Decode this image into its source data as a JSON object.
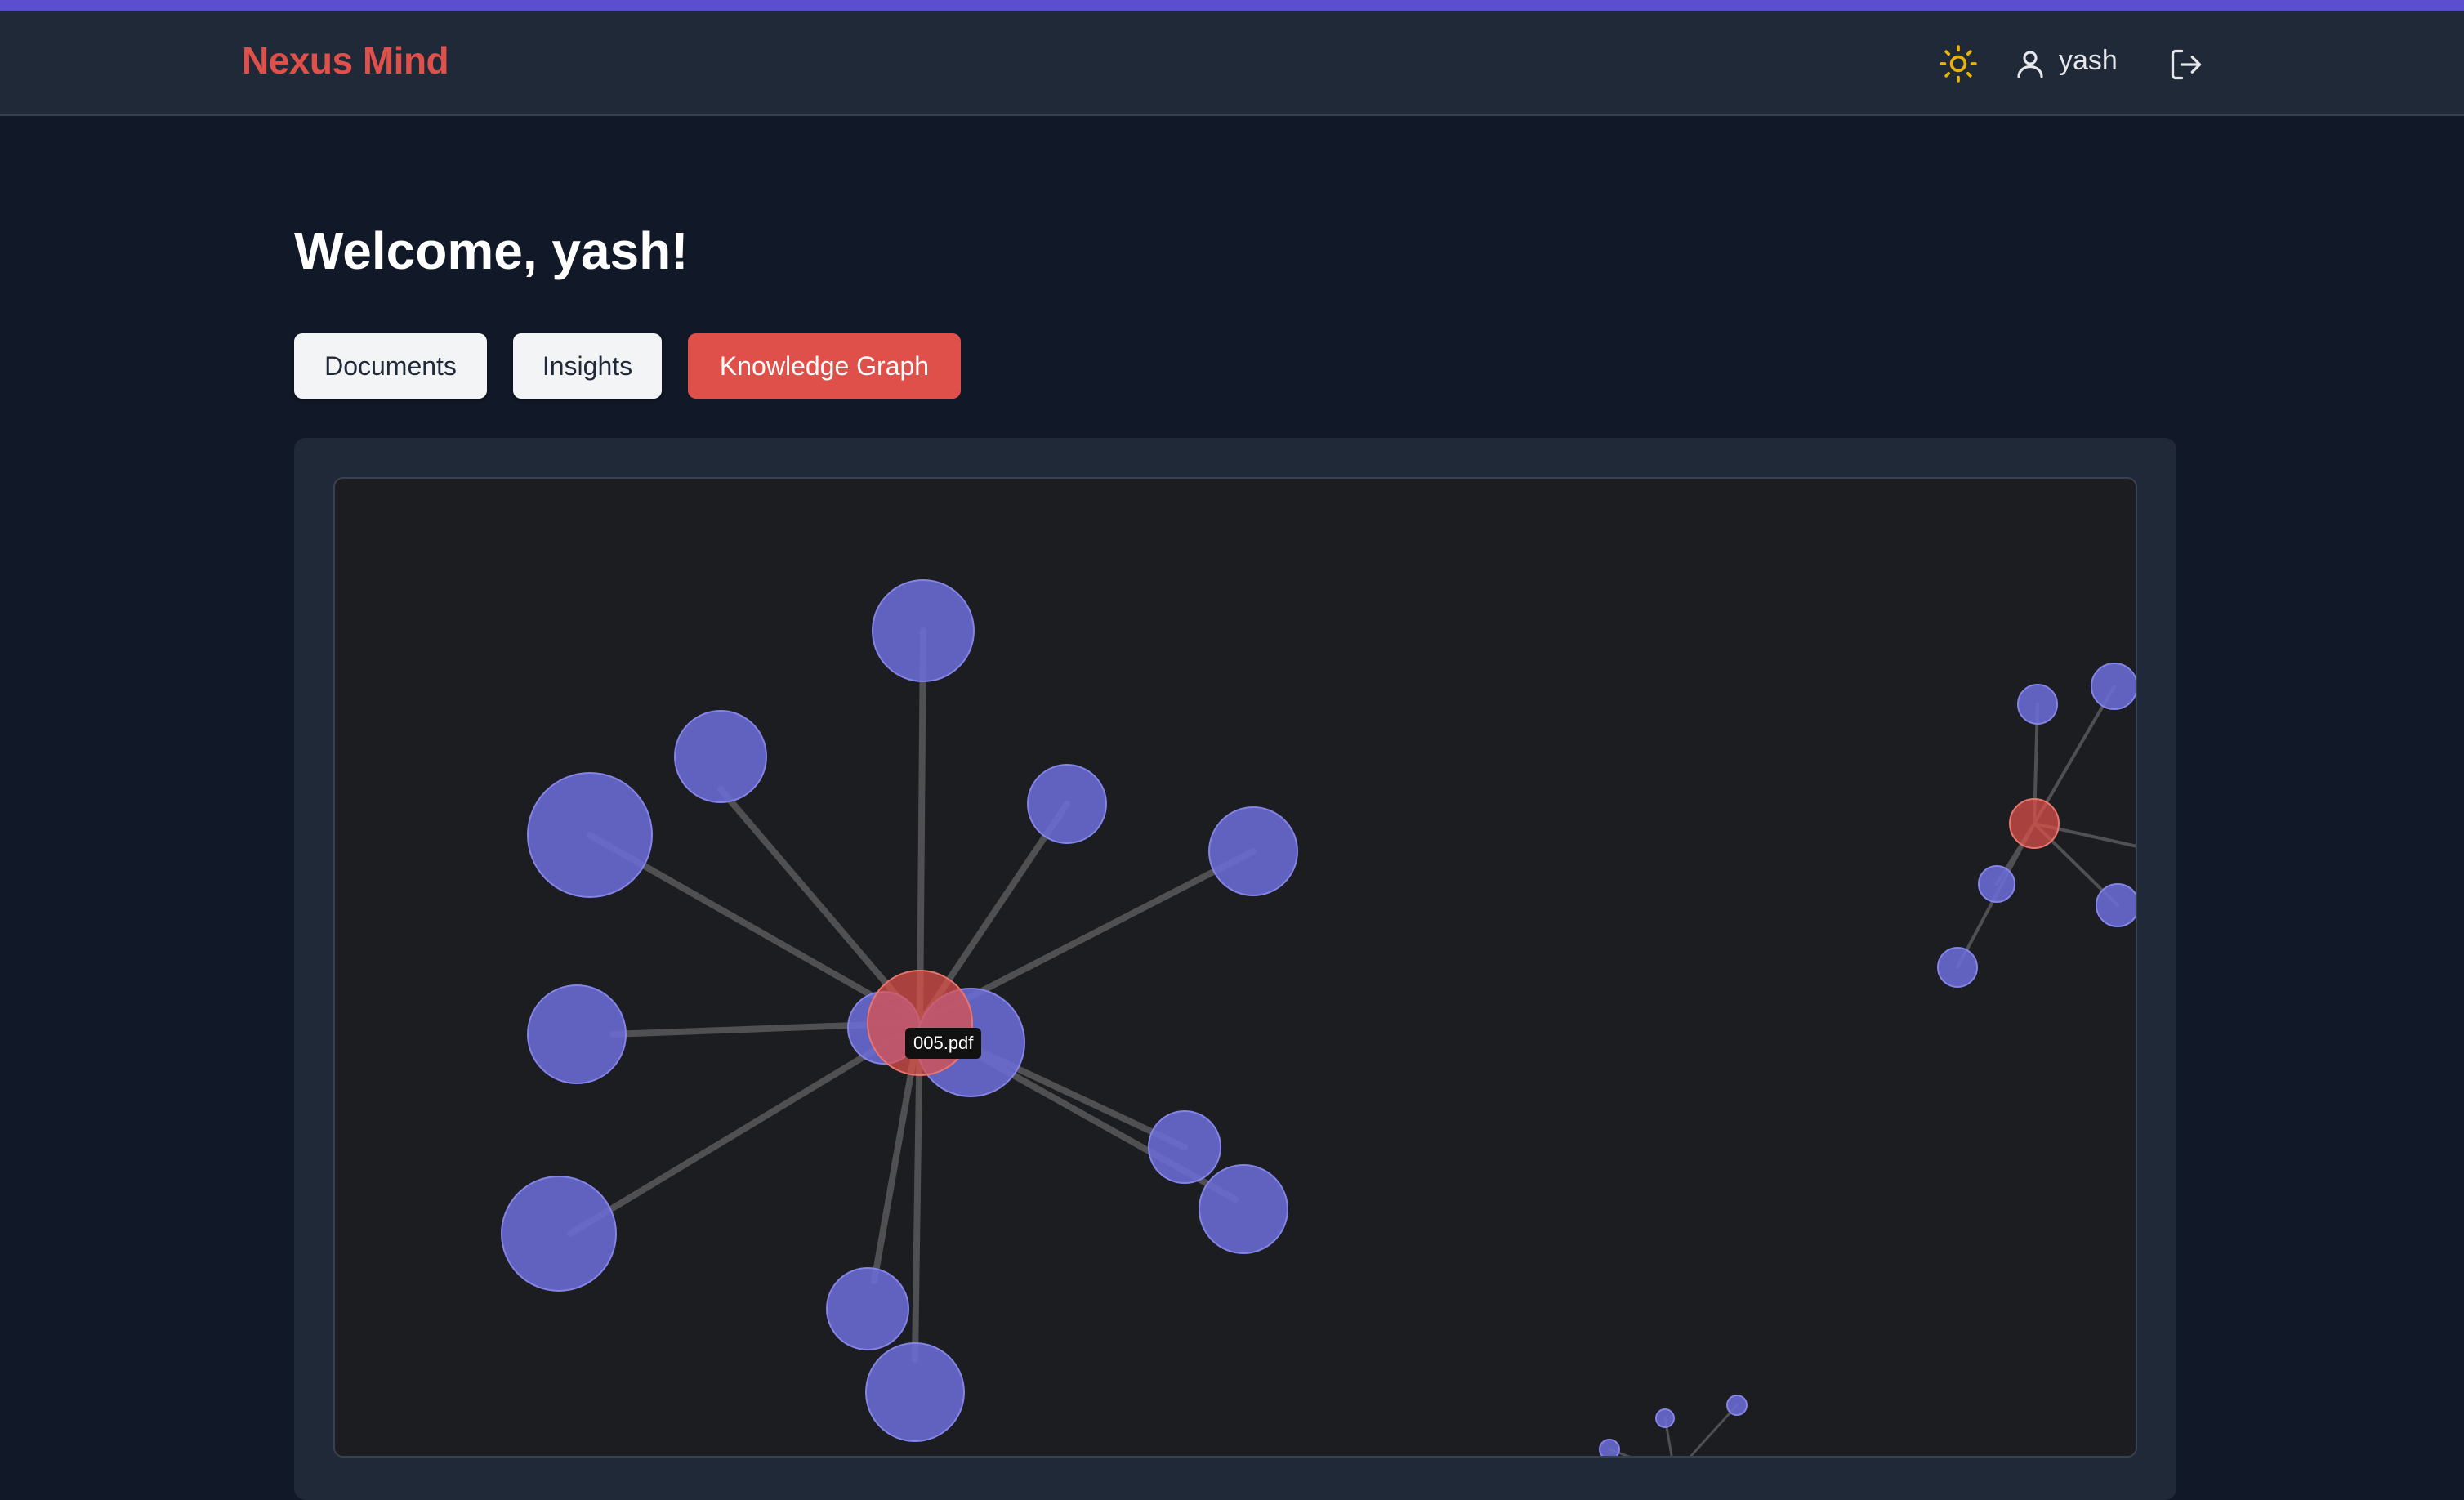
{
  "brand": {
    "name": "Nexus Mind",
    "color": "#e0504a"
  },
  "header": {
    "theme_icon": "sun-icon",
    "user_icon": "user-icon",
    "username": "yash",
    "logout_icon": "logout-icon"
  },
  "welcome": {
    "title": "Welcome, yash!"
  },
  "tabs": [
    {
      "label": "Documents",
      "active": false
    },
    {
      "label": "Insights",
      "active": false
    },
    {
      "label": "Knowledge Graph",
      "active": true
    }
  ],
  "graph": {
    "tooltip": "005.pdf",
    "colors": {
      "document_node": "#e0504a",
      "concept_node": "#6b6bd6",
      "edge": "#555555"
    }
  }
}
